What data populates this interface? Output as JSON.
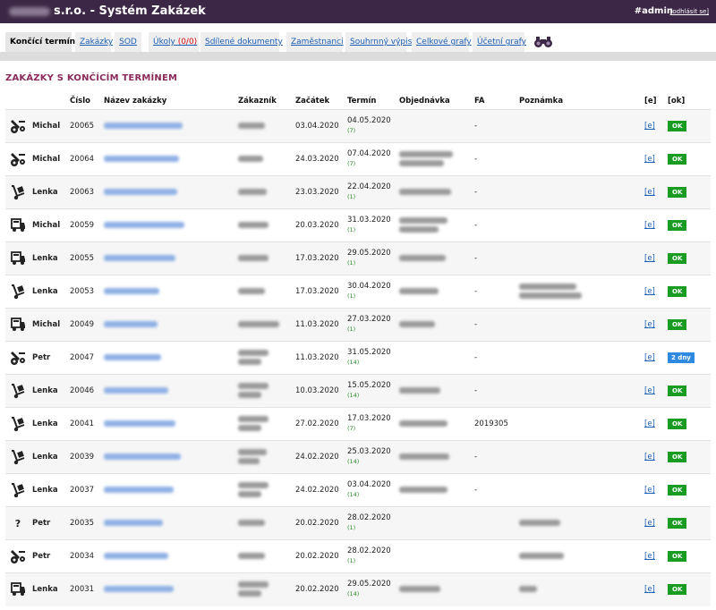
{
  "header": {
    "title": "s.r.o. - Systém Zakázek",
    "user": "#admin",
    "logout": "[odhlásit se]"
  },
  "tabs": [
    {
      "label": "Končící termíny"
    },
    {
      "label": "Zakázky"
    },
    {
      "label": "SOD"
    },
    {
      "label": "Úkoly",
      "count": "(0/0)"
    },
    {
      "label": "Sdílené dokumenty"
    },
    {
      "label": "Zaměstnanci"
    },
    {
      "label": "Souhrnný výpis"
    },
    {
      "label": "Celkové grafy"
    },
    {
      "label": "Účetní grafy"
    }
  ],
  "section_title": "ZAKÁZKY S KONČÍCÍM TERMÍNEM",
  "columns": {
    "cislo": "Číslo",
    "nazev": "Název zakázky",
    "zakaznik": "Zákazník",
    "zacatek": "Začátek",
    "termin": "Termín",
    "objednavka": "Objednávka",
    "fa": "FA",
    "poznamka": "Poznámka",
    "e": "[e]",
    "ok": "[ok]"
  },
  "rows": [
    {
      "icon": "gear-truck-icon",
      "employee": "Michal",
      "number": "20065",
      "start": "03.04.2020",
      "term": "04.05.2020",
      "days": "(7)",
      "fa": "-",
      "e": "[e]",
      "action": "OK",
      "action_type": "ok"
    },
    {
      "icon": "gear-truck-icon",
      "employee": "Michal",
      "number": "20064",
      "start": "24.03.2020",
      "term": "07.04.2020",
      "days": "(7)",
      "fa": "-",
      "e": "[e]",
      "action": "OK",
      "action_type": "ok"
    },
    {
      "icon": "hand-truck-icon",
      "employee": "Lenka",
      "number": "20063",
      "start": "23.03.2020",
      "term": "22.04.2020",
      "days": "(1)",
      "fa": "-",
      "e": "[e]",
      "action": "OK",
      "action_type": "ok"
    },
    {
      "icon": "delivery-truck-icon",
      "employee": "Michal",
      "number": "20059",
      "start": "20.03.2020",
      "term": "31.03.2020",
      "days": "(1)",
      "fa": "-",
      "e": "[e]",
      "action": "OK",
      "action_type": "ok"
    },
    {
      "icon": "delivery-truck-icon",
      "employee": "Lenka",
      "number": "20055",
      "start": "17.03.2020",
      "term": "29.05.2020",
      "days": "(1)",
      "fa": "-",
      "e": "[e]",
      "action": "OK",
      "action_type": "ok"
    },
    {
      "icon": "hand-truck-icon",
      "employee": "Lenka",
      "number": "20053",
      "start": "17.03.2020",
      "term": "30.04.2020",
      "days": "(1)",
      "fa": "-",
      "e": "[e]",
      "action": "OK",
      "action_type": "ok"
    },
    {
      "icon": "delivery-truck-icon",
      "employee": "Michal",
      "number": "20049",
      "start": "11.03.2020",
      "term": "27.03.2020",
      "days": "(1)",
      "fa": "-",
      "e": "[e]",
      "action": "OK",
      "action_type": "ok"
    },
    {
      "icon": "gear-truck-icon",
      "employee": "Petr",
      "number": "20047",
      "start": "11.03.2020",
      "term": "31.05.2020",
      "days": "(14)",
      "fa": "-",
      "e": "[e]",
      "action": "2 dny",
      "action_type": "dny"
    },
    {
      "icon": "hand-truck-icon",
      "employee": "Lenka",
      "number": "20046",
      "start": "10.03.2020",
      "term": "15.05.2020",
      "days": "(14)",
      "fa": "-",
      "e": "[e]",
      "action": "OK",
      "action_type": "ok"
    },
    {
      "icon": "hand-truck-icon",
      "employee": "Lenka",
      "number": "20041",
      "start": "27.02.2020",
      "term": "17.03.2020",
      "days": "(7)",
      "fa": "2019305",
      "e": "[e]",
      "action": "OK",
      "action_type": "ok"
    },
    {
      "icon": "hand-truck-icon",
      "employee": "Lenka",
      "number": "20039",
      "start": "24.02.2020",
      "term": "25.03.2020",
      "days": "(14)",
      "fa": "-",
      "e": "[e]",
      "action": "OK",
      "action_type": "ok"
    },
    {
      "icon": "hand-truck-icon",
      "employee": "Lenka",
      "number": "20037",
      "start": "24.02.2020",
      "term": "03.04.2020",
      "days": "(14)",
      "fa": "-",
      "e": "[e]",
      "action": "OK",
      "action_type": "ok"
    },
    {
      "icon": "question-icon",
      "employee": "Petr",
      "number": "20035",
      "start": "20.02.2020",
      "term": "28.02.2020",
      "days": "(1)",
      "fa": "",
      "e": "[e]",
      "action": "OK",
      "action_type": "ok"
    },
    {
      "icon": "gear-truck-icon",
      "employee": "Petr",
      "number": "20034",
      "start": "20.02.2020",
      "term": "28.02.2020",
      "days": "(1)",
      "fa": "",
      "e": "[e]",
      "action": "OK",
      "action_type": "ok"
    },
    {
      "icon": "delivery-truck-icon",
      "employee": "Lenka",
      "number": "20031",
      "start": "20.02.2020",
      "term": "29.05.2020",
      "days": "(14)",
      "fa": "",
      "e": "[e]",
      "action": "OK",
      "action_type": "ok"
    }
  ],
  "icon_glyphs": {
    "question-icon": "?"
  }
}
